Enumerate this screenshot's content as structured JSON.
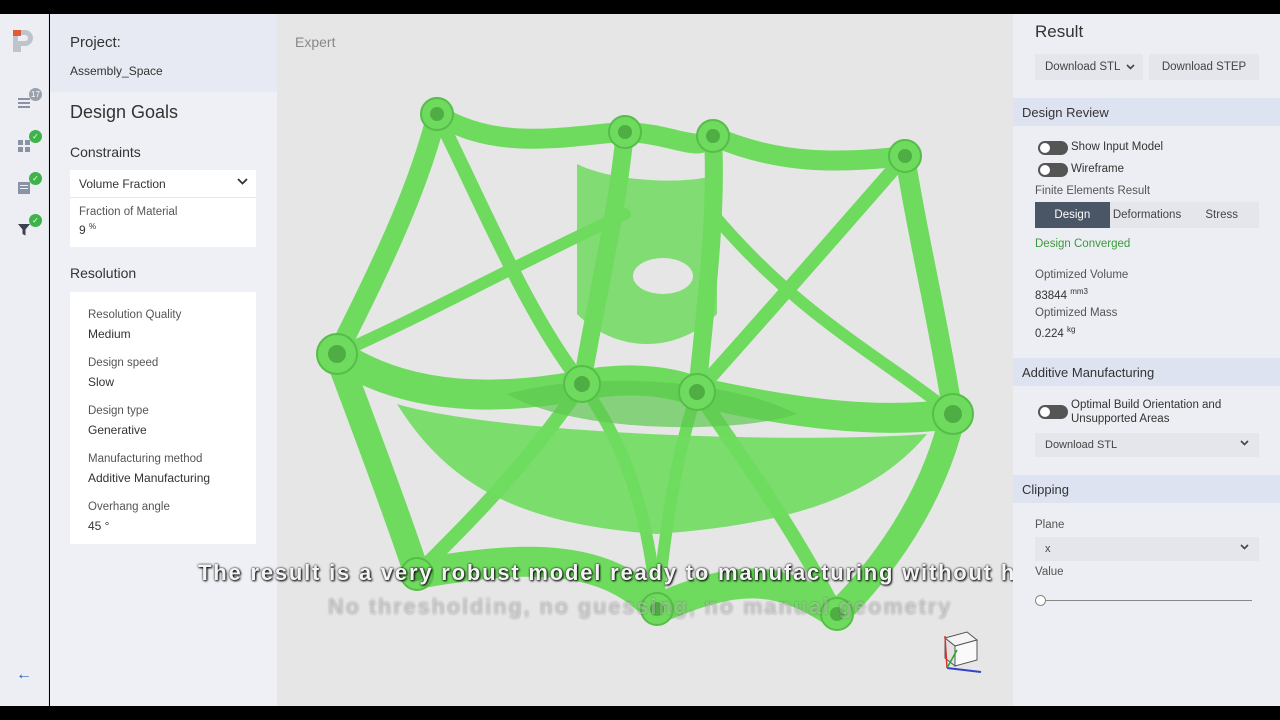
{
  "colors": {
    "accent_blue": "#2b5fb8",
    "model_green": "#6edb5e",
    "status_green": "#3a9a3a",
    "active_tab": "#4a5566"
  },
  "rail": {
    "logo_icon": "logo-p-icon",
    "items": [
      {
        "icon": "list-icon",
        "badge": "17"
      },
      {
        "icon": "grid-icon",
        "badge": "✓"
      },
      {
        "icon": "document-icon",
        "badge": "✓"
      },
      {
        "icon": "filter-icon",
        "badge": "✓"
      }
    ],
    "back_icon": "arrow-left-icon",
    "back_glyph": "←"
  },
  "left": {
    "project_label": "Project:",
    "project_name": "Assembly_Space",
    "design_goals": "Design Goals",
    "constraints": "Constraints",
    "volume_fraction": "Volume Fraction",
    "fraction_label": "Fraction of Material",
    "fraction_value": "9",
    "fraction_unit": "%",
    "resolution": "Resolution",
    "res_items": [
      {
        "label": "Resolution Quality",
        "value": "Medium"
      },
      {
        "label": "Design speed",
        "value": "Slow"
      },
      {
        "label": "Design type",
        "value": "Generative"
      },
      {
        "label": "Manufacturing method",
        "value": "Additive Manufacturing"
      },
      {
        "label": "Overhang angle",
        "value": "45 °"
      }
    ]
  },
  "viewport": {
    "mode": "Expert",
    "subtitle": "The result is a very robust model ready to manufacturing without human",
    "subtitle2": "No thresholding, no guessing, no manual geometry"
  },
  "right": {
    "title": "Result",
    "download_stl": "Download STL",
    "download_step": "Download STEP",
    "design_review": "Design Review",
    "show_input": "Show Input Model",
    "wireframe": "Wireframe",
    "fe_result": "Finite Elements Result",
    "tabs": [
      "Design",
      "Deformations",
      "Stress"
    ],
    "converged": "Design Converged",
    "opt_volume_label": "Optimized Volume",
    "opt_volume_value": "83844",
    "opt_volume_unit": "mm3",
    "opt_mass_label": "Optimized Mass",
    "opt_mass_value": "0.224",
    "opt_mass_unit": "kg",
    "additive": "Additive Manufacturing",
    "build_orientation": "Optimal Build Orientation and Unsupported Areas",
    "am_download": "Download STL",
    "clipping": "Clipping",
    "plane_label": "Plane",
    "plane_value": "x",
    "value_label": "Value",
    "slider_value": 0
  }
}
